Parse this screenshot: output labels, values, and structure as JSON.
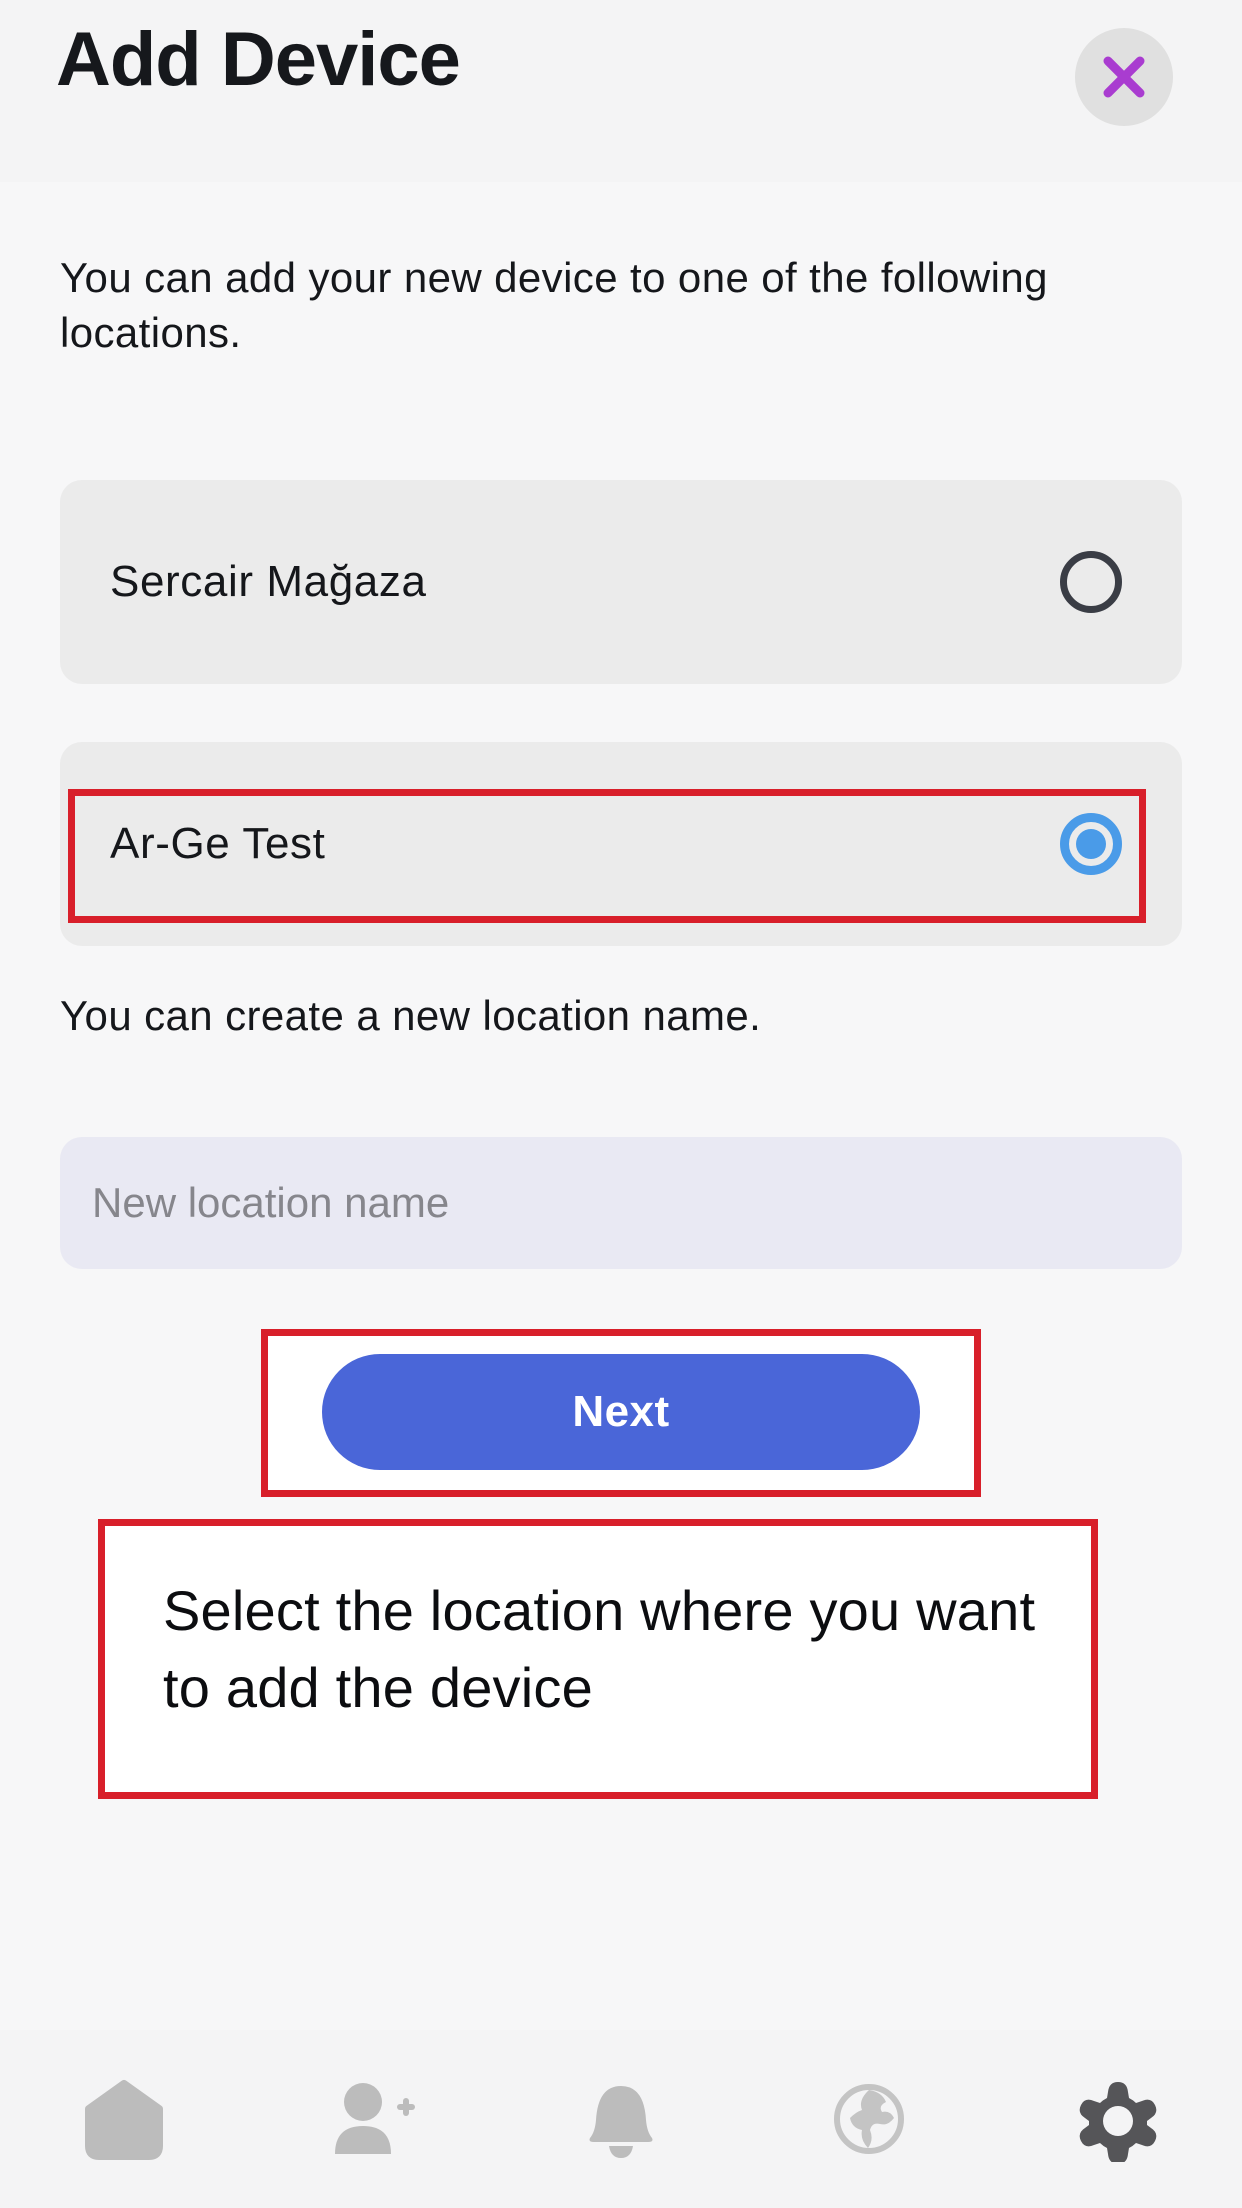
{
  "header": {
    "title": "Add Device",
    "close_icon": "close-x-icon",
    "close_icon_color": "#a93cd0",
    "close_bg_color": "#e0e0e0"
  },
  "main": {
    "intro_text": "You can add your new device to one of the following locations.",
    "locations": [
      {
        "label": "Sercair Mağaza",
        "selected": false
      },
      {
        "label": "Ar-Ge Test",
        "selected": true
      }
    ],
    "create_location_text": "You can create a new location name.",
    "new_location_input": {
      "value": "",
      "placeholder": "New location name"
    },
    "next_button_label": "Next"
  },
  "annotations": {
    "callout_text": "Select the location where you want to add the device",
    "border_color": "#d81f2a"
  },
  "bottom_nav": {
    "items": [
      {
        "icon": "home-icon",
        "active": false
      },
      {
        "icon": "add-person-icon",
        "active": false
      },
      {
        "icon": "bell-icon",
        "active": false
      },
      {
        "icon": "globe-icon",
        "active": false
      },
      {
        "icon": "gear-icon",
        "active": true
      }
    ],
    "inactive_color": "#bcbcbc",
    "active_color": "#555558"
  },
  "colors": {
    "accent_blue": "#4a66d8",
    "radio_selected": "#4a9be8",
    "radio_unselected": "#3a3d45",
    "card_bg": "#ebebeb",
    "input_bg": "#e9e9f3",
    "page_bg": "#f7f7f8"
  }
}
